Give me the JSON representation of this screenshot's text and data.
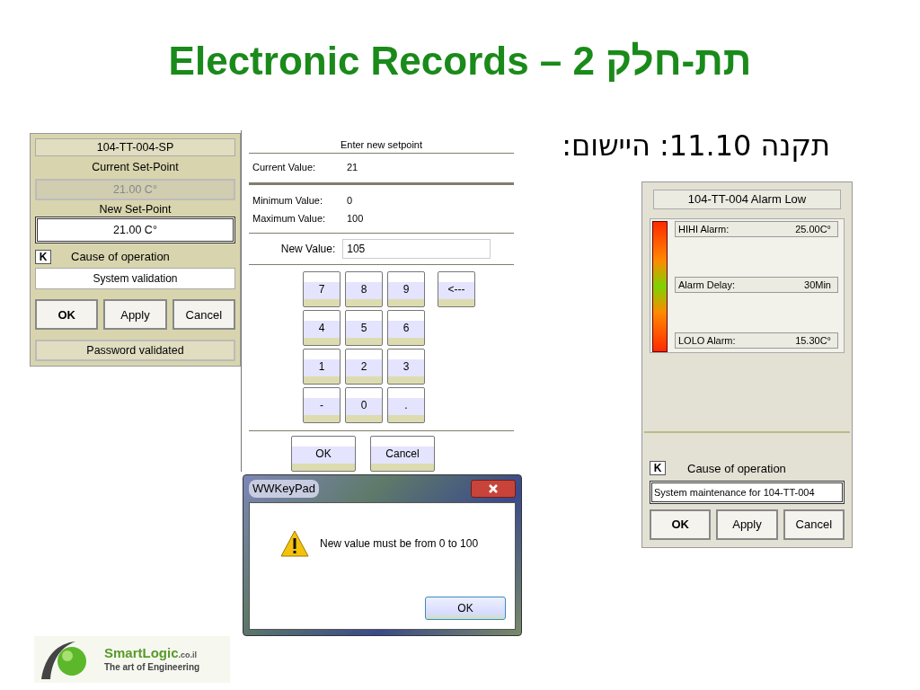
{
  "slide": {
    "title": "Electronic Records – 2 תת-חלק",
    "subtitle": "תקנה 11.10: היישום:"
  },
  "setpoint_panel": {
    "tag": "104-TT-004-SP",
    "current_label": "Current Set-Point",
    "current_value": "21.00 C°",
    "new_label": "New Set-Point",
    "new_value": "21.00 C°",
    "key": "K",
    "cause_label": "Cause of operation",
    "cause_value": "System validation",
    "buttons": [
      {
        "label": "OK",
        "default": true
      },
      {
        "label": "Apply",
        "default": false
      },
      {
        "label": "Cancel",
        "default": false
      }
    ],
    "status": "Password validated"
  },
  "keypad": {
    "title": "Enter new setpoint",
    "rows": [
      {
        "label": "Current Value:",
        "value": "21"
      },
      {
        "label": "Minimum Value:",
        "value": "0"
      },
      {
        "label": "Maximum Value:",
        "value": "100"
      }
    ],
    "new_value_label": "New Value:",
    "new_value": "105",
    "keys": [
      [
        "7",
        "8",
        "9",
        "<---"
      ],
      [
        "4",
        "5",
        "6"
      ],
      [
        "1",
        "2",
        "3"
      ],
      [
        "-",
        "0",
        "."
      ]
    ],
    "buttons": [
      "OK",
      "Cancel"
    ]
  },
  "alert": {
    "title": "WWKeyPad",
    "message": "New value must be from 0 to 100",
    "button": "OK"
  },
  "alarm_panel": {
    "title": "104-TT-004 Alarm Low",
    "rows": [
      {
        "label": "HIHI Alarm:",
        "value": "25.00C°"
      },
      {
        "label": "Alarm Delay:",
        "value": "30Min"
      },
      {
        "label": "LOLO Alarm:",
        "value": "15.30C°"
      }
    ],
    "key": "K",
    "cause_label": "Cause of operation",
    "cause_value": "System maintenance for 104-TT-004",
    "buttons": [
      {
        "label": "OK",
        "default": true
      },
      {
        "label": "Apply",
        "default": false
      },
      {
        "label": "Cancel",
        "default": false
      }
    ]
  },
  "logo": {
    "name": "SmartLogic",
    "domain": ".co.il",
    "tagline": "The art of Engineering"
  }
}
